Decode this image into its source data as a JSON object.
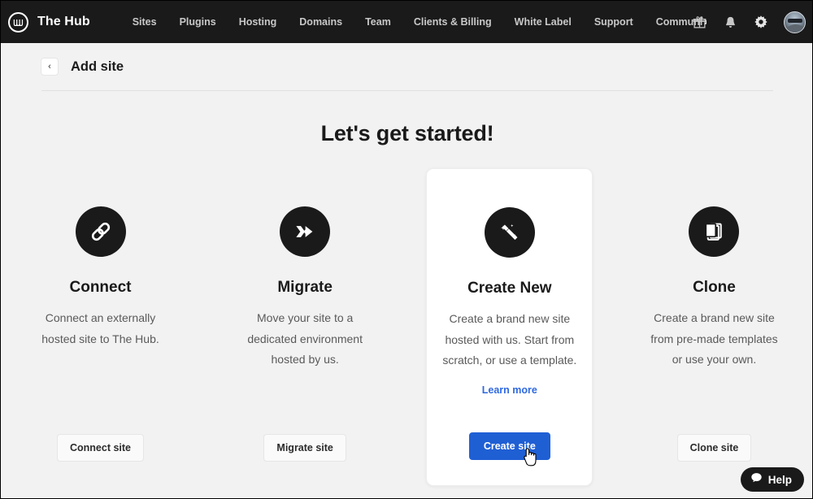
{
  "navbar": {
    "logo_icon": "hub-circle-logo-icon",
    "brand": "The Hub",
    "links": [
      {
        "label": "Sites"
      },
      {
        "label": "Plugins"
      },
      {
        "label": "Hosting"
      },
      {
        "label": "Domains"
      },
      {
        "label": "Team"
      },
      {
        "label": "Clients & Billing"
      },
      {
        "label": "White Label"
      },
      {
        "label": "Support"
      },
      {
        "label": "Communi",
        "truncated": true,
        "chevron": "›"
      }
    ],
    "icons": [
      {
        "name": "gift-icon"
      },
      {
        "name": "bell-icon"
      },
      {
        "name": "gear-icon"
      }
    ],
    "avatar_alt": "user-avatar",
    "background": "#1a1a1a"
  },
  "subheader": {
    "back_label": "‹",
    "title": "Add site"
  },
  "main": {
    "headline": "Let's get started!",
    "cards": [
      {
        "id": "connect",
        "icon": "link-chain-icon",
        "title": "Connect",
        "description": "Connect an externally hosted site to The Hub.",
        "button": "Connect site",
        "featured": false
      },
      {
        "id": "migrate",
        "icon": "arrow-transfer-icon",
        "title": "Migrate",
        "description": "Move your site to a dedicated environment hosted by us.",
        "button": "Migrate site",
        "featured": false
      },
      {
        "id": "create-new",
        "icon": "magic-wand-icon",
        "title": "Create New",
        "description": "Create a brand new site hosted with us. Start from scratch, or use a template.",
        "link_label": "Learn more",
        "button": "Create site",
        "featured": true
      },
      {
        "id": "clone",
        "icon": "copy-documents-icon",
        "title": "Clone",
        "description": "Create a brand new site from pre-made templates or use your own.",
        "button": "Clone site",
        "featured": false
      }
    ]
  },
  "help_widget": {
    "icon": "chat-bubble-icon",
    "label": "Help"
  },
  "colors": {
    "page_background": "#f2f2f2",
    "navbar": "#1a1a1a",
    "accent_blue": "#1f5fd4",
    "link_blue": "#2f69e0",
    "card_white": "#ffffff",
    "text_primary": "#1a1a1a",
    "text_secondary": "#5a5a5a"
  }
}
